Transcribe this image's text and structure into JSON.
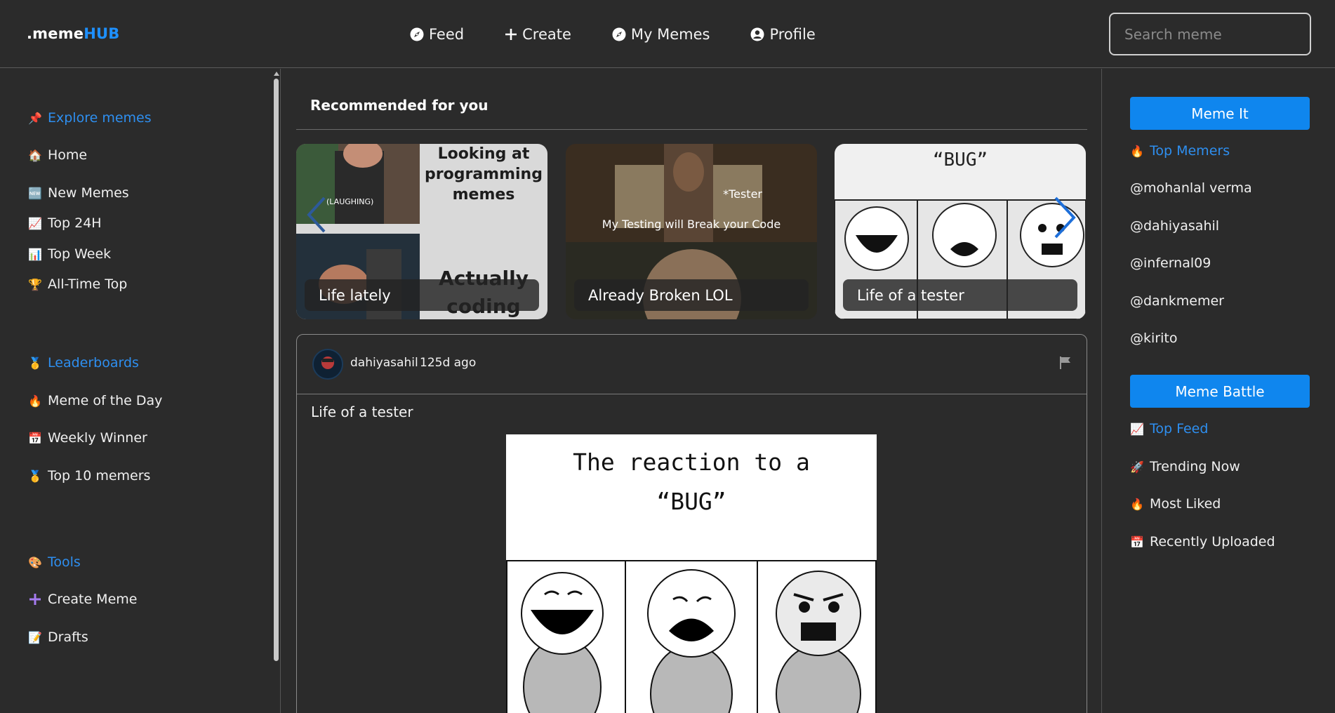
{
  "header": {
    "logo_prefix": ".meme",
    "logo_accent": "HUB",
    "nav": [
      {
        "label": "Feed",
        "icon": "compass-icon"
      },
      {
        "label": "Create",
        "icon": "plus-icon"
      },
      {
        "label": "My Memes",
        "icon": "compass-icon"
      },
      {
        "label": "Profile",
        "icon": "user-circle-icon"
      }
    ],
    "search_placeholder": "Search meme"
  },
  "sidebar": {
    "explore": {
      "title": "Explore memes",
      "icon": "pushpin-icon",
      "items": [
        {
          "label": "Home",
          "icon": "house-icon"
        },
        {
          "label": "New Memes",
          "icon": "new-icon"
        },
        {
          "label": "Top 24H",
          "icon": "chart-up-icon"
        },
        {
          "label": "Top Week",
          "icon": "bar-chart-icon"
        },
        {
          "label": "All-Time Top",
          "icon": "trophy-icon"
        }
      ]
    },
    "leaderboards": {
      "title": "Leaderboards",
      "icon": "medal-icon",
      "items": [
        {
          "label": "Meme of the Day",
          "icon": "fire-icon"
        },
        {
          "label": "Weekly Winner",
          "icon": "calendar-icon"
        },
        {
          "label": "Top 10 memers",
          "icon": "medal-icon"
        }
      ]
    },
    "tools": {
      "title": "Tools",
      "icon": "palette-icon",
      "items": [
        {
          "label": "Create Meme",
          "icon": "plus-icon"
        },
        {
          "label": "Drafts",
          "icon": "memo-icon"
        }
      ]
    }
  },
  "main": {
    "recommended_title": "Recommended for you",
    "cards": [
      {
        "caption": "Life lately",
        "top_text": "Looking at programming memes",
        "bottom_text": "Actually coding",
        "inset": "(LAUGHING)"
      },
      {
        "caption": "Already Broken LOL",
        "top_text": "*Tester",
        "mid_text": "My Testing will Break your Code"
      },
      {
        "caption": "Life of a tester",
        "top_text": "“BUG”"
      }
    ],
    "post": {
      "user": "dahiyasahil",
      "time": "125d ago",
      "title": "Life of a tester",
      "image_text_line1": "The reaction to a",
      "image_text_line2": "“BUG”"
    }
  },
  "right": {
    "meme_it": "Meme It",
    "top_memers": {
      "title": "Top Memers",
      "icon": "fire-icon",
      "users": [
        "@mohanlal verma",
        "@dahiyasahil",
        "@infernal09",
        "@dankmemer",
        "@kirito"
      ]
    },
    "meme_battle": "Meme Battle",
    "top_feed": {
      "title": "Top Feed",
      "icon": "chart-up-icon",
      "items": [
        {
          "label": "Trending Now",
          "icon": "rocket-icon"
        },
        {
          "label": "Most Liked",
          "icon": "fire-icon"
        },
        {
          "label": "Recently Uploaded",
          "icon": "calendar-icon"
        }
      ]
    }
  },
  "colors": {
    "accent": "#1e90ff",
    "button": "#0f86ee",
    "background": "#2b2b2b"
  }
}
